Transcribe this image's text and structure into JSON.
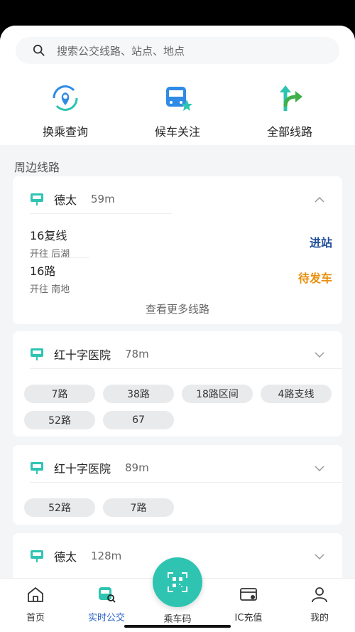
{
  "search": {
    "placeholder": "搜索公交线路、站点、地点"
  },
  "quick_actions": [
    {
      "label": "换乘查询",
      "icon": "transfer-location-icon"
    },
    {
      "label": "候车关注",
      "icon": "bus-star-icon"
    },
    {
      "label": "全部线路",
      "icon": "route-arrows-icon"
    }
  ],
  "section_title": "周边线路",
  "stops": [
    {
      "name": "德太",
      "distance": "59m",
      "expanded": true,
      "routes": [
        {
          "name": "16复线",
          "direction": "开往 后湖",
          "status": "进站",
          "status_color": "#1f4f9a"
        },
        {
          "name": "16路",
          "direction": "开往 南地",
          "status": "待发车",
          "status_color": "#e8900f"
        }
      ],
      "more_label": "查看更多线路"
    },
    {
      "name": "红十字医院",
      "distance": "78m",
      "chips": [
        "7路",
        "38路",
        "18路区间",
        "4路支线",
        "52路",
        "67"
      ]
    },
    {
      "name": "红十字医院",
      "distance": "89m",
      "chips": [
        "52路",
        "7路"
      ]
    },
    {
      "name": "德太",
      "distance": "128m"
    }
  ],
  "tabs": [
    {
      "label": "首页",
      "icon": "home-icon"
    },
    {
      "label": "实时公交",
      "icon": "bus-search-icon",
      "active": true
    },
    {
      "label": "乘车码",
      "icon": "qr-code-icon"
    },
    {
      "label": "IC充值",
      "icon": "ic-card-icon"
    },
    {
      "label": "我的",
      "icon": "profile-icon"
    }
  ],
  "colors": {
    "teal": "#2ec4b1",
    "accent_blue": "#2a63c8",
    "arrival": "#1f4f9a",
    "waiting": "#e8900f"
  }
}
